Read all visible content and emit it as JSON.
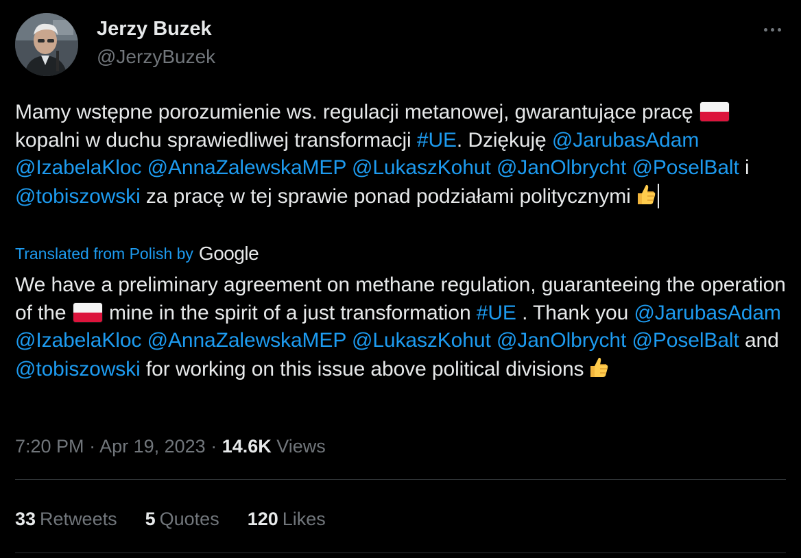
{
  "author": {
    "display_name": "Jerzy Buzek",
    "handle": "@JerzyBuzek"
  },
  "original": {
    "p1": "Mamy wstępne porozumienie ws. regulacji metanowej, gwarantujące pracę ",
    "p2": " kopalni w duchu sprawiedliwej transformacji ",
    "hashtag": "#UE",
    "p3": ". Dziękuję ",
    "mentions": [
      "@JarubasAdam",
      "@IzabelaKloc",
      "@AnnaZalewskaMEP",
      "@LukaszKohut",
      "@JanOlbrycht",
      "@PoselBalt"
    ],
    "joiner": " i ",
    "last_mention": "@tobiszowski",
    "p4": " za pracę w tej sprawie ponad podziałami politycznymi"
  },
  "translation_notice": {
    "label": "Translated from Polish by",
    "provider": "Google"
  },
  "translated": {
    "p1": "We have a preliminary agreement on methane regulation, guaranteeing the operation of the ",
    "p2": " mine in the spirit of a just transformation ",
    "hashtag": "#UE",
    "p3": " . Thank you ",
    "mentions": [
      "@JarubasAdam",
      "@IzabelaKloc",
      "@AnnaZalewskaMEP",
      "@LukaszKohut",
      "@JanOlbrycht",
      "@PoselBalt"
    ],
    "joiner": " and ",
    "last_mention": "@tobiszowski",
    "p4": " for working on this issue above political divisions"
  },
  "meta": {
    "time": "7:20 PM",
    "separator": " · ",
    "date": "Apr 19, 2023",
    "views_count": "14.6K",
    "views_label": " Views"
  },
  "stats": {
    "retweets_count": "33",
    "retweets_label": "Retweets",
    "quotes_count": "5",
    "quotes_label": "Quotes",
    "likes_count": "120",
    "likes_label": "Likes"
  },
  "icons": {
    "flag": "poland-flag-icon",
    "thumb": "thumbs-up-icon",
    "more": "more-horizontal-icon"
  },
  "colors": {
    "background": "#000000",
    "text": "#e7e9ea",
    "secondary": "#71767b",
    "link": "#1d9bf0",
    "divider": "#2f3336"
  }
}
